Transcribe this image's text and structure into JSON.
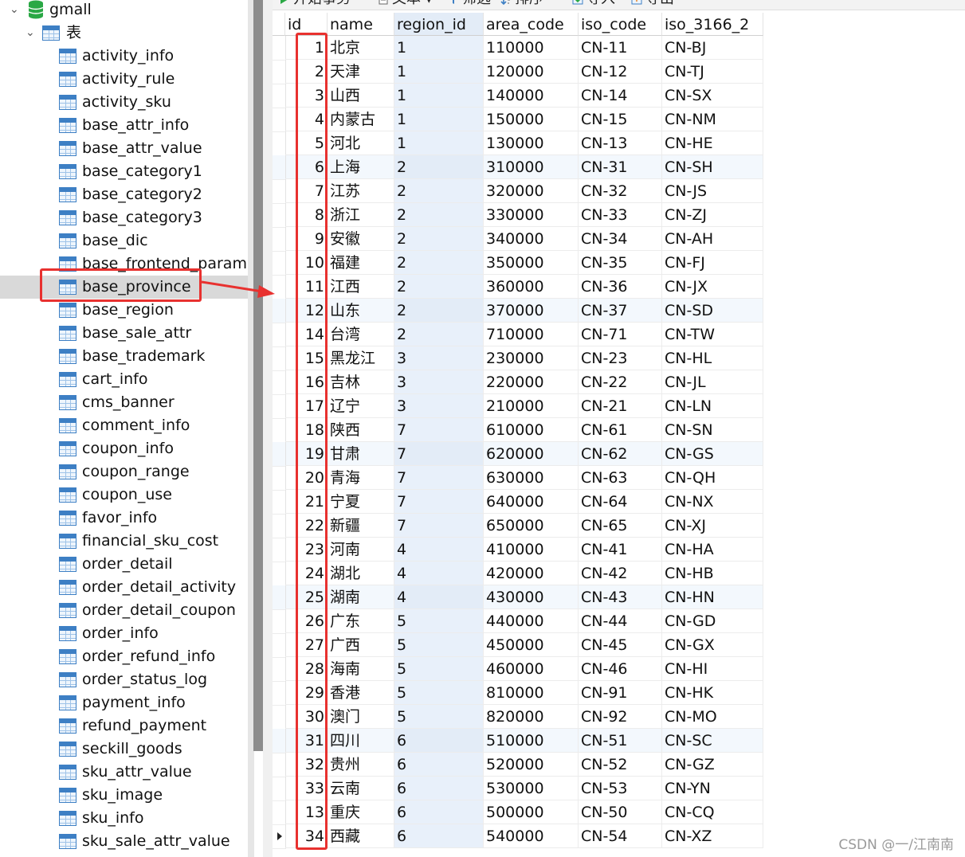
{
  "tree": {
    "database": "gmall",
    "group": "表",
    "tables": [
      "activity_info",
      "activity_rule",
      "activity_sku",
      "base_attr_info",
      "base_attr_value",
      "base_category1",
      "base_category2",
      "base_category3",
      "base_dic",
      "base_frontend_param",
      "base_province",
      "base_region",
      "base_sale_attr",
      "base_trademark",
      "cart_info",
      "cms_banner",
      "comment_info",
      "coupon_info",
      "coupon_range",
      "coupon_use",
      "favor_info",
      "financial_sku_cost",
      "order_detail",
      "order_detail_activity",
      "order_detail_coupon",
      "order_info",
      "order_refund_info",
      "order_status_log",
      "payment_info",
      "refund_payment",
      "seckill_goods",
      "sku_attr_value",
      "sku_image",
      "sku_info",
      "sku_sale_attr_value"
    ],
    "selected_table": "base_province"
  },
  "toolbar": {
    "begin_transaction": "开始事务",
    "text": "文本",
    "filter": "筛选",
    "sort": "排序",
    "import": "导入",
    "export": "导出"
  },
  "grid": {
    "columns": [
      "id",
      "name",
      "region_id",
      "area_code",
      "iso_code",
      "iso_3166_2"
    ],
    "rows": [
      [
        "1",
        "北京",
        "1",
        "110000",
        "CN-11",
        "CN-BJ"
      ],
      [
        "2",
        "天津",
        "1",
        "120000",
        "CN-12",
        "CN-TJ"
      ],
      [
        "3",
        "山西",
        "1",
        "140000",
        "CN-14",
        "CN-SX"
      ],
      [
        "4",
        "内蒙古",
        "1",
        "150000",
        "CN-15",
        "CN-NM"
      ],
      [
        "5",
        "河北",
        "1",
        "130000",
        "CN-13",
        "CN-HE"
      ],
      [
        "6",
        "上海",
        "2",
        "310000",
        "CN-31",
        "CN-SH"
      ],
      [
        "7",
        "江苏",
        "2",
        "320000",
        "CN-32",
        "CN-JS"
      ],
      [
        "8",
        "浙江",
        "2",
        "330000",
        "CN-33",
        "CN-ZJ"
      ],
      [
        "9",
        "安徽",
        "2",
        "340000",
        "CN-34",
        "CN-AH"
      ],
      [
        "10",
        "福建",
        "2",
        "350000",
        "CN-35",
        "CN-FJ"
      ],
      [
        "11",
        "江西",
        "2",
        "360000",
        "CN-36",
        "CN-JX"
      ],
      [
        "12",
        "山东",
        "2",
        "370000",
        "CN-37",
        "CN-SD"
      ],
      [
        "14",
        "台湾",
        "2",
        "710000",
        "CN-71",
        "CN-TW"
      ],
      [
        "15",
        "黑龙江",
        "3",
        "230000",
        "CN-23",
        "CN-HL"
      ],
      [
        "16",
        "吉林",
        "3",
        "220000",
        "CN-22",
        "CN-JL"
      ],
      [
        "17",
        "辽宁",
        "3",
        "210000",
        "CN-21",
        "CN-LN"
      ],
      [
        "18",
        "陕西",
        "7",
        "610000",
        "CN-61",
        "CN-SN"
      ],
      [
        "19",
        "甘肃",
        "7",
        "620000",
        "CN-62",
        "CN-GS"
      ],
      [
        "20",
        "青海",
        "7",
        "630000",
        "CN-63",
        "CN-QH"
      ],
      [
        "21",
        "宁夏",
        "7",
        "640000",
        "CN-64",
        "CN-NX"
      ],
      [
        "22",
        "新疆",
        "7",
        "650000",
        "CN-65",
        "CN-XJ"
      ],
      [
        "23",
        "河南",
        "4",
        "410000",
        "CN-41",
        "CN-HA"
      ],
      [
        "24",
        "湖北",
        "4",
        "420000",
        "CN-42",
        "CN-HB"
      ],
      [
        "25",
        "湖南",
        "4",
        "430000",
        "CN-43",
        "CN-HN"
      ],
      [
        "26",
        "广东",
        "5",
        "440000",
        "CN-44",
        "CN-GD"
      ],
      [
        "27",
        "广西",
        "5",
        "450000",
        "CN-45",
        "CN-GX"
      ],
      [
        "28",
        "海南",
        "5",
        "460000",
        "CN-46",
        "CN-HI"
      ],
      [
        "29",
        "香港",
        "5",
        "810000",
        "CN-91",
        "CN-HK"
      ],
      [
        "30",
        "澳门",
        "5",
        "820000",
        "CN-92",
        "CN-MO"
      ],
      [
        "31",
        "四川",
        "6",
        "510000",
        "CN-51",
        "CN-SC"
      ],
      [
        "32",
        "贵州",
        "6",
        "520000",
        "CN-52",
        "CN-GZ"
      ],
      [
        "33",
        "云南",
        "6",
        "530000",
        "CN-53",
        "CN-YN"
      ],
      [
        "13",
        "重庆",
        "6",
        "500000",
        "CN-50",
        "CN-CQ"
      ],
      [
        "34",
        "西藏",
        "6",
        "540000",
        "CN-54",
        "CN-XZ"
      ]
    ],
    "selected_column": "region_id",
    "current_row": 33
  },
  "colors": {
    "annotation": "#e8312f",
    "selection": "#d9d9d9",
    "icon_blue": "#3d7fc4",
    "db_green": "#2aa845"
  },
  "watermark": "CSDN @一/江南南"
}
